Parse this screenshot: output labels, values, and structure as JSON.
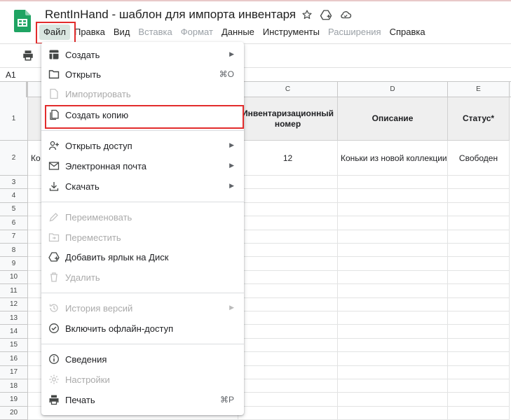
{
  "document": {
    "title": "RentInHand - шаблон для импорта инвентаря"
  },
  "menubar": {
    "items": [
      {
        "label": "Файл",
        "state": "active"
      },
      {
        "label": "Правка",
        "state": "normal"
      },
      {
        "label": "Вид",
        "state": "normal"
      },
      {
        "label": "Вставка",
        "state": "disabled"
      },
      {
        "label": "Формат",
        "state": "disabled"
      },
      {
        "label": "Данные",
        "state": "normal"
      },
      {
        "label": "Инструменты",
        "state": "normal"
      },
      {
        "label": "Расширения",
        "state": "disabled"
      },
      {
        "label": "Справка",
        "state": "normal"
      }
    ]
  },
  "namebox": {
    "value": "A1"
  },
  "sheet": {
    "columns": [
      "C",
      "D",
      "E"
    ],
    "rows": [
      "1",
      "2",
      "3",
      "4",
      "5",
      "6",
      "7",
      "8",
      "9",
      "10",
      "11",
      "12",
      "13",
      "14",
      "15",
      "16",
      "17",
      "18",
      "19",
      "20"
    ],
    "header_row": {
      "c": "Инвентаризационный номер",
      "d": "Описание",
      "e": "Статус*"
    },
    "data_row": {
      "b_partial": "Ко",
      "c": "12",
      "d": "Коньки из новой коллекции",
      "e": "Свободен"
    }
  },
  "file_menu": {
    "create": {
      "label": "Создать",
      "icon": "new-sheet-icon"
    },
    "open": {
      "label": "Открыть",
      "shortcut": "⌘O",
      "icon": "folder-icon"
    },
    "import": {
      "label": "Импортировать",
      "icon": "file-icon",
      "disabled": true
    },
    "copy": {
      "label": "Создать копию",
      "icon": "copy-icon"
    },
    "share": {
      "label": "Открыть доступ",
      "icon": "person-add-icon"
    },
    "email": {
      "label": "Электронная почта",
      "icon": "mail-icon"
    },
    "download": {
      "label": "Скачать",
      "icon": "download-icon"
    },
    "rename": {
      "label": "Переименовать",
      "icon": "pencil-icon",
      "disabled": true
    },
    "move": {
      "label": "Переместить",
      "icon": "move-folder-icon",
      "disabled": true
    },
    "shortcut": {
      "label": "Добавить ярлык на Диск",
      "icon": "drive-shortcut-icon"
    },
    "delete": {
      "label": "Удалить",
      "icon": "trash-icon",
      "disabled": true
    },
    "history": {
      "label": "История версий",
      "icon": "history-icon",
      "disabled": true
    },
    "offline": {
      "label": "Включить офлайн-доступ",
      "icon": "offline-check-icon"
    },
    "details": {
      "label": "Сведения",
      "icon": "info-icon"
    },
    "settings": {
      "label": "Настройки",
      "icon": "gear-icon",
      "disabled": true
    },
    "print": {
      "label": "Печать",
      "shortcut": "⌘P",
      "icon": "print-icon"
    }
  },
  "colors": {
    "highlight_box": "#e22c2c",
    "sheets_green": "#1fa463",
    "active_menu_bg": "#d9e6e0",
    "disabled_text": "#aaaaaa"
  }
}
